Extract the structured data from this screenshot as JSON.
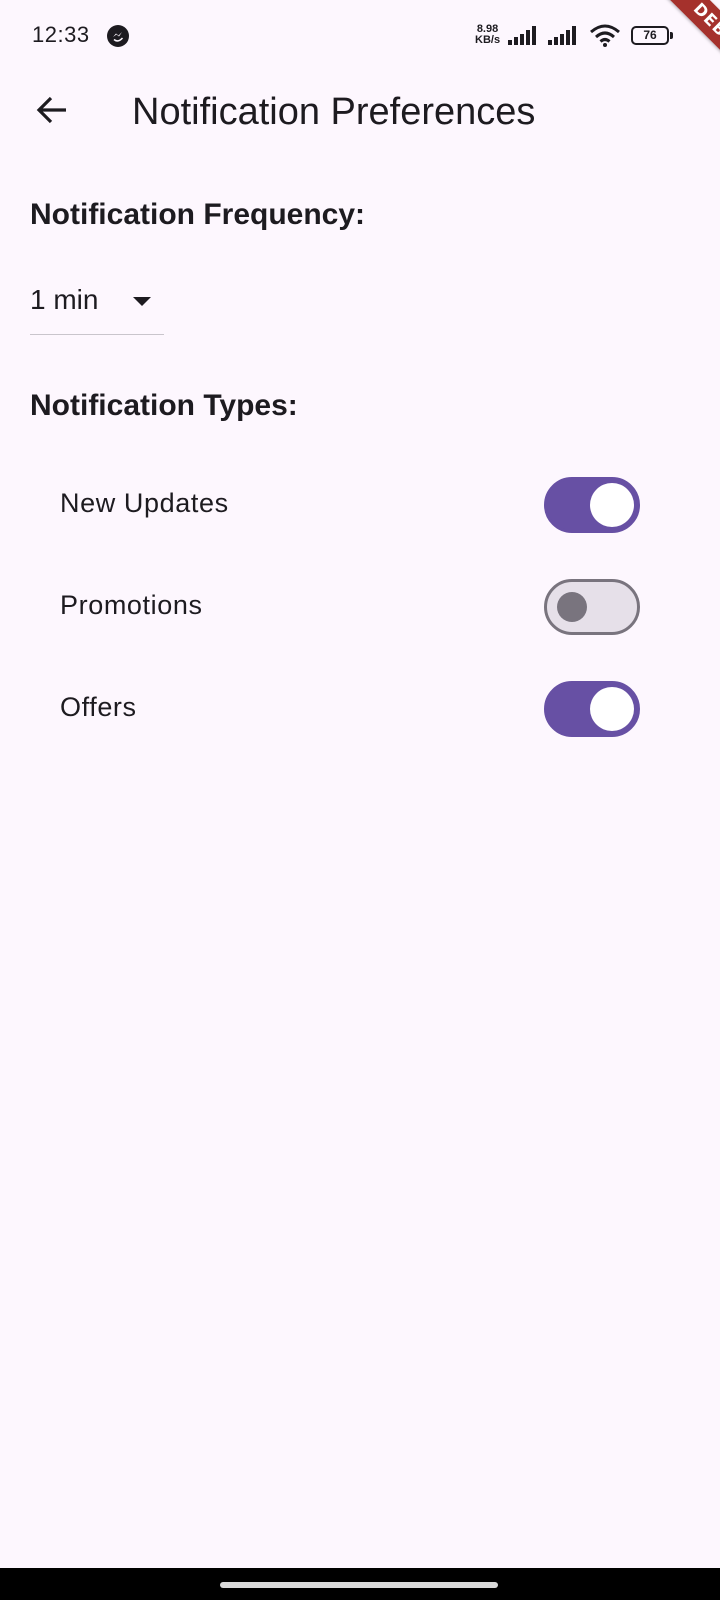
{
  "status_bar": {
    "time": "12:33",
    "net_speed_value": "8.98",
    "net_speed_unit": "KB/s",
    "battery": "76",
    "icons": [
      "messenger-icon",
      "signal-icon",
      "signal-icon",
      "wifi-icon",
      "battery-icon"
    ]
  },
  "debug_banner": "DEBUG",
  "app_bar": {
    "back_icon": "arrow-left-icon",
    "title": "Notification Preferences"
  },
  "frequency": {
    "heading": "Notification Frequency:",
    "selected": "1 min",
    "arrow_icon": "dropdown-arrow-icon"
  },
  "types": {
    "heading": "Notification Types:",
    "items": [
      {
        "label": "New Updates",
        "enabled": true
      },
      {
        "label": "Promotions",
        "enabled": false
      },
      {
        "label": "Offers",
        "enabled": true
      }
    ]
  },
  "colors": {
    "background": "#fdf7fe",
    "primary": "#6750a4",
    "outline": "#79747e",
    "text": "#1d1b20"
  }
}
